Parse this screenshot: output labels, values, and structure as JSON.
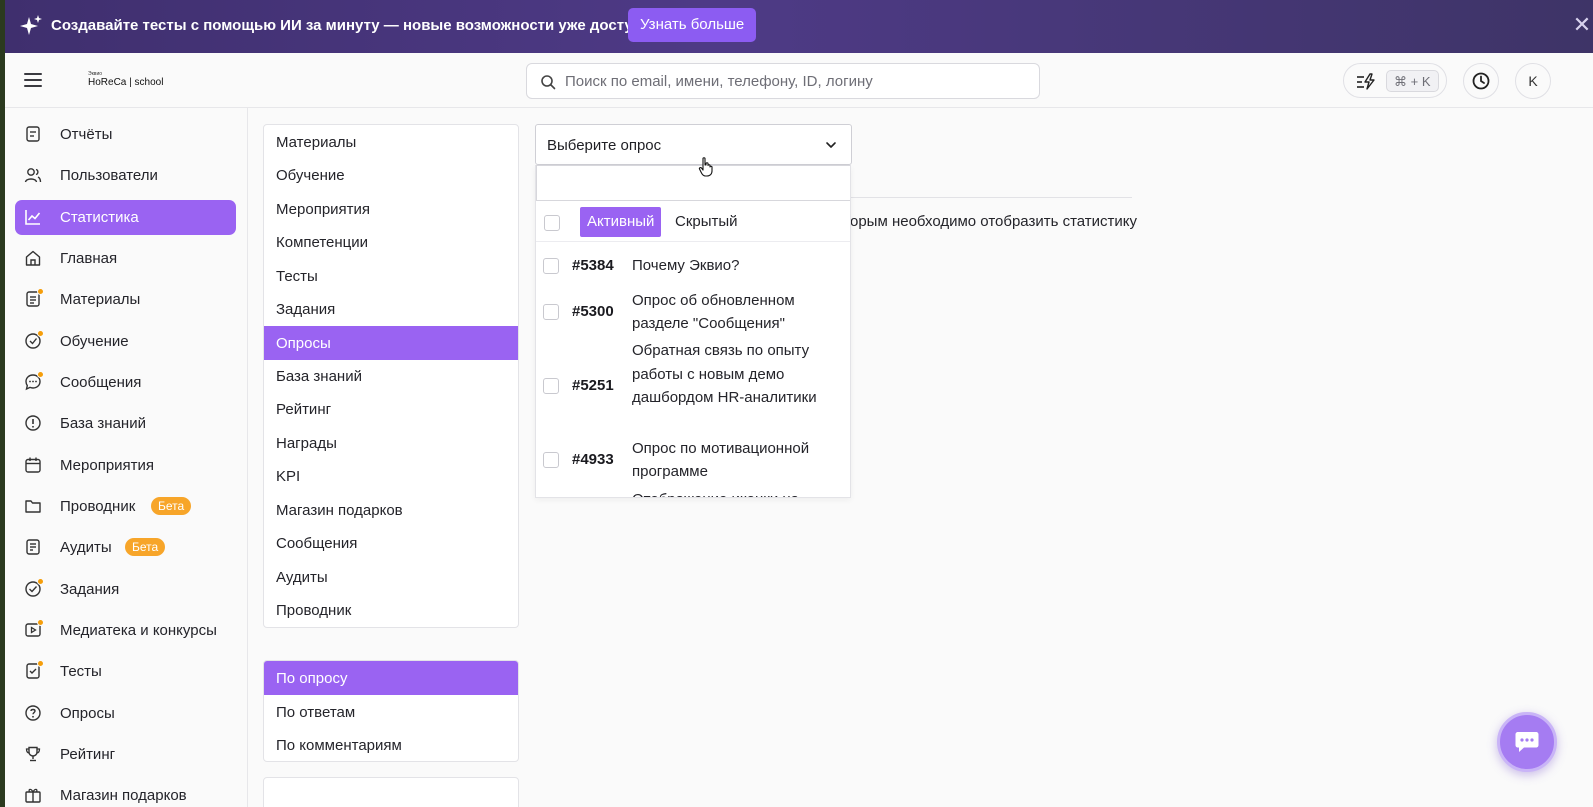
{
  "banner": {
    "text": "Создавайте тесты с помощью ИИ за минуту — новые возможности уже доступны!",
    "button": "Узнать больше",
    "close": "✕",
    "icon": "sparkle-icon"
  },
  "header": {
    "logo_small": "Эквио",
    "logo_text": "HoReCa | school",
    "search_placeholder": "Поиск по email, имени, телефону, ID, логину",
    "shortcut": "⌘ + K",
    "avatar": "K"
  },
  "sidebar": {
    "items": [
      {
        "label": "Отчёты",
        "icon": "reports-icon"
      },
      {
        "label": "Пользователи",
        "icon": "users-icon"
      },
      {
        "label": "Статистика",
        "icon": "chart-icon",
        "active": true
      },
      {
        "label": "Главная",
        "icon": "home-icon"
      },
      {
        "label": "Материалы",
        "icon": "materials-icon",
        "dot": true
      },
      {
        "label": "Обучение",
        "icon": "learning-icon",
        "dot": true
      },
      {
        "label": "Сообщения",
        "icon": "messages-icon",
        "dot": true
      },
      {
        "label": "База знаний",
        "icon": "knowledge-icon"
      },
      {
        "label": "Мероприятия",
        "icon": "calendar-icon"
      },
      {
        "label": "Проводник",
        "icon": "folder-icon",
        "badge": "Бета"
      },
      {
        "label": "Аудиты",
        "icon": "audit-icon",
        "badge": "Бета"
      },
      {
        "label": "Задания",
        "icon": "tasks-icon",
        "dot": true
      },
      {
        "label": "Медиатека и конкурсы",
        "icon": "media-icon",
        "dot": true
      },
      {
        "label": "Тесты",
        "icon": "tests-icon",
        "dot": true
      },
      {
        "label": "Опросы",
        "icon": "survey-icon"
      },
      {
        "label": "Рейтинг",
        "icon": "trophy-icon"
      },
      {
        "label": "Магазин подарков",
        "icon": "gift-icon"
      }
    ]
  },
  "modules": {
    "items": [
      "Материалы",
      "Обучение",
      "Мероприятия",
      "Компетенции",
      "Тесты",
      "Задания",
      "Опросы",
      "База знаний",
      "Рейтинг",
      "Награды",
      "KPI",
      "Магазин подарков",
      "Сообщения",
      "Аудиты",
      "Проводник"
    ],
    "active": "Опросы"
  },
  "views": {
    "items": [
      "По опросу",
      "По ответам",
      "По комментариям"
    ],
    "active": "По опросу"
  },
  "content": {
    "select_value": "Выберите опрос",
    "hint_text": "орым необходимо отобразить статистику",
    "search_value": "",
    "tab_active": "Активный",
    "tab_hidden": "Скрытый",
    "surveys": [
      {
        "id": "#5384",
        "name": "Почему Эквио?"
      },
      {
        "id": "#5300",
        "name": "Опрос об обновленном разделе \"Сообщения\""
      },
      {
        "id": "#5251",
        "name": "Обратная связь по опыту работы с новым демо дашбордом HR-аналитики"
      },
      {
        "id": "#4933",
        "name": "Опрос по мотивационной программе"
      },
      {
        "id": "",
        "name": "Отображение иконки на"
      }
    ]
  },
  "colors": {
    "accent": "#9a63f2",
    "banner": "#45357a",
    "badge": "#f7a529"
  }
}
